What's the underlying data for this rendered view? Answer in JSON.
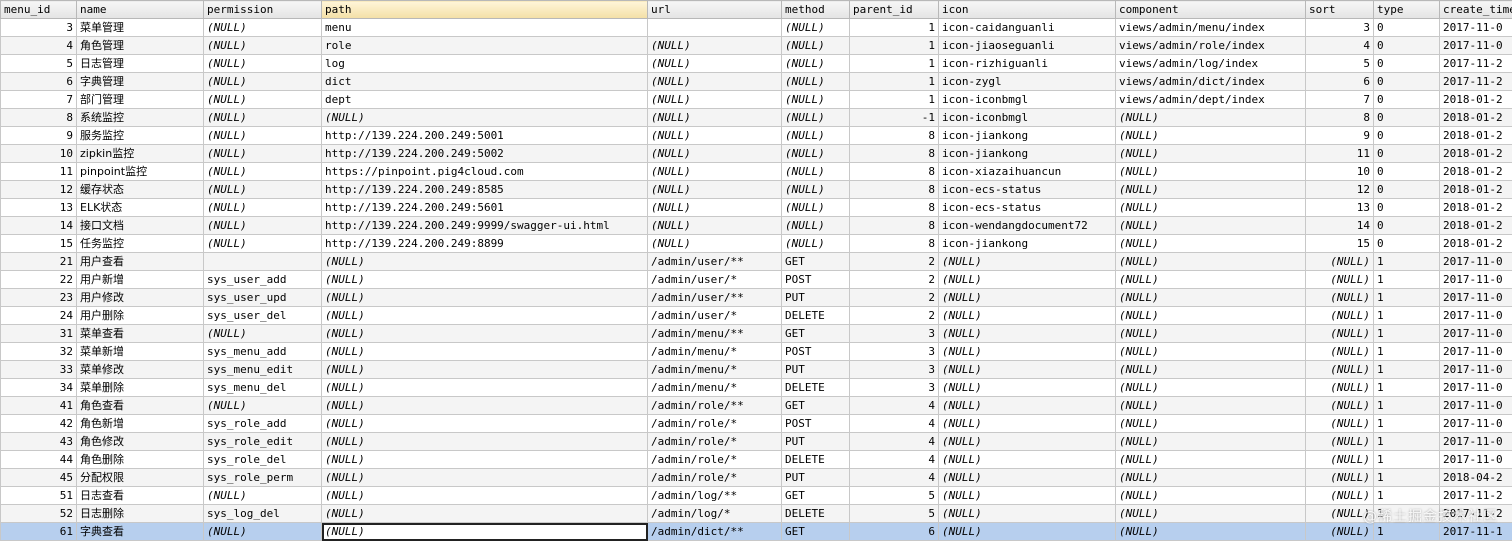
{
  "columns": [
    "menu_id",
    "name",
    "permission",
    "path",
    "url",
    "method",
    "parent_id",
    "icon",
    "component",
    "sort",
    "type",
    "create_time"
  ],
  "null_text": "(NULL)",
  "selected_row": 28,
  "focused_column": 3,
  "rows": [
    [
      "3",
      "菜单管理",
      "(NULL)",
      "menu",
      "",
      "(NULL)",
      "1",
      "icon-caidanguanli",
      "views/admin/menu/index",
      "3",
      "0",
      "2017-11-0"
    ],
    [
      "4",
      "角色管理",
      "(NULL)",
      "role",
      "(NULL)",
      "(NULL)",
      "1",
      "icon-jiaoseguanli",
      "views/admin/role/index",
      "4",
      "0",
      "2017-11-0"
    ],
    [
      "5",
      "日志管理",
      "(NULL)",
      "log",
      "(NULL)",
      "(NULL)",
      "1",
      "icon-rizhiguanli",
      "views/admin/log/index",
      "5",
      "0",
      "2017-11-2"
    ],
    [
      "6",
      "字典管理",
      "(NULL)",
      "dict",
      "(NULL)",
      "(NULL)",
      "1",
      "icon-zygl",
      "views/admin/dict/index",
      "6",
      "0",
      "2017-11-2"
    ],
    [
      "7",
      "部门管理",
      "(NULL)",
      "dept",
      "(NULL)",
      "(NULL)",
      "1",
      "icon-iconbmgl",
      "views/admin/dept/index",
      "7",
      "0",
      "2018-01-2"
    ],
    [
      "8",
      "系统监控",
      "(NULL)",
      "(NULL)",
      "(NULL)",
      "(NULL)",
      "-1",
      "icon-iconbmgl",
      "(NULL)",
      "8",
      "0",
      "2018-01-2"
    ],
    [
      "9",
      "服务监控",
      "(NULL)",
      "http://139.224.200.249:5001",
      "(NULL)",
      "(NULL)",
      "8",
      "icon-jiankong",
      "(NULL)",
      "9",
      "0",
      "2018-01-2"
    ],
    [
      "10",
      "zipkin监控",
      "(NULL)",
      "http://139.224.200.249:5002",
      "(NULL)",
      "(NULL)",
      "8",
      "icon-jiankong",
      "(NULL)",
      "11",
      "0",
      "2018-01-2"
    ],
    [
      "11",
      "pinpoint监控",
      "(NULL)",
      "https://pinpoint.pig4cloud.com",
      "(NULL)",
      "(NULL)",
      "8",
      "icon-xiazaihuancun",
      "(NULL)",
      "10",
      "0",
      "2018-01-2"
    ],
    [
      "12",
      "缓存状态",
      "(NULL)",
      "http://139.224.200.249:8585",
      "(NULL)",
      "(NULL)",
      "8",
      "icon-ecs-status",
      "(NULL)",
      "12",
      "0",
      "2018-01-2"
    ],
    [
      "13",
      "ELK状态",
      "(NULL)",
      "http://139.224.200.249:5601",
      "(NULL)",
      "(NULL)",
      "8",
      "icon-ecs-status",
      "(NULL)",
      "13",
      "0",
      "2018-01-2"
    ],
    [
      "14",
      "接口文档",
      "(NULL)",
      "http://139.224.200.249:9999/swagger-ui.html",
      "(NULL)",
      "(NULL)",
      "8",
      "icon-wendangdocument72",
      "(NULL)",
      "14",
      "0",
      "2018-01-2"
    ],
    [
      "15",
      "任务监控",
      "(NULL)",
      "http://139.224.200.249:8899",
      "(NULL)",
      "(NULL)",
      "8",
      "icon-jiankong",
      "(NULL)",
      "15",
      "0",
      "2018-01-2"
    ],
    [
      "21",
      "用户查看",
      "",
      "(NULL)",
      "/admin/user/**",
      "GET",
      "2",
      "(NULL)",
      "(NULL)",
      "(NULL)",
      "1",
      "2017-11-0"
    ],
    [
      "22",
      "用户新增",
      "sys_user_add",
      "(NULL)",
      "/admin/user/*",
      "POST",
      "2",
      "(NULL)",
      "(NULL)",
      "(NULL)",
      "1",
      "2017-11-0"
    ],
    [
      "23",
      "用户修改",
      "sys_user_upd",
      "(NULL)",
      "/admin/user/**",
      "PUT",
      "2",
      "(NULL)",
      "(NULL)",
      "(NULL)",
      "1",
      "2017-11-0"
    ],
    [
      "24",
      "用户删除",
      "sys_user_del",
      "(NULL)",
      "/admin/user/*",
      "DELETE",
      "2",
      "(NULL)",
      "(NULL)",
      "(NULL)",
      "1",
      "2017-11-0"
    ],
    [
      "31",
      "菜单查看",
      "(NULL)",
      "(NULL)",
      "/admin/menu/**",
      "GET",
      "3",
      "(NULL)",
      "(NULL)",
      "(NULL)",
      "1",
      "2017-11-0"
    ],
    [
      "32",
      "菜单新增",
      "sys_menu_add",
      "(NULL)",
      "/admin/menu/*",
      "POST",
      "3",
      "(NULL)",
      "(NULL)",
      "(NULL)",
      "1",
      "2017-11-0"
    ],
    [
      "33",
      "菜单修改",
      "sys_menu_edit",
      "(NULL)",
      "/admin/menu/*",
      "PUT",
      "3",
      "(NULL)",
      "(NULL)",
      "(NULL)",
      "1",
      "2017-11-0"
    ],
    [
      "34",
      "菜单删除",
      "sys_menu_del",
      "(NULL)",
      "/admin/menu/*",
      "DELETE",
      "3",
      "(NULL)",
      "(NULL)",
      "(NULL)",
      "1",
      "2017-11-0"
    ],
    [
      "41",
      "角色查看",
      "(NULL)",
      "(NULL)",
      "/admin/role/**",
      "GET",
      "4",
      "(NULL)",
      "(NULL)",
      "(NULL)",
      "1",
      "2017-11-0"
    ],
    [
      "42",
      "角色新增",
      "sys_role_add",
      "(NULL)",
      "/admin/role/*",
      "POST",
      "4",
      "(NULL)",
      "(NULL)",
      "(NULL)",
      "1",
      "2017-11-0"
    ],
    [
      "43",
      "角色修改",
      "sys_role_edit",
      "(NULL)",
      "/admin/role/*",
      "PUT",
      "4",
      "(NULL)",
      "(NULL)",
      "(NULL)",
      "1",
      "2017-11-0"
    ],
    [
      "44",
      "角色删除",
      "sys_role_del",
      "(NULL)",
      "/admin/role/*",
      "DELETE",
      "4",
      "(NULL)",
      "(NULL)",
      "(NULL)",
      "1",
      "2017-11-0"
    ],
    [
      "45",
      "分配权限",
      "sys_role_perm",
      "(NULL)",
      "/admin/role/*",
      "PUT",
      "4",
      "(NULL)",
      "(NULL)",
      "(NULL)",
      "1",
      "2018-04-2"
    ],
    [
      "51",
      "日志查看",
      "(NULL)",
      "(NULL)",
      "/admin/log/**",
      "GET",
      "5",
      "(NULL)",
      "(NULL)",
      "(NULL)",
      "1",
      "2017-11-2"
    ],
    [
      "52",
      "日志删除",
      "sys_log_del",
      "(NULL)",
      "/admin/log/*",
      "DELETE",
      "5",
      "(NULL)",
      "(NULL)",
      "(NULL)",
      "1",
      "2017-11-2"
    ],
    [
      "61",
      "字典查看",
      "(NULL)",
      "(NULL)",
      "/admin/dict/**",
      "GET",
      "6",
      "(NULL)",
      "(NULL)",
      "(NULL)",
      "1",
      "2017-11-1"
    ]
  ],
  "watermark": "@稀土掘金技术社区"
}
